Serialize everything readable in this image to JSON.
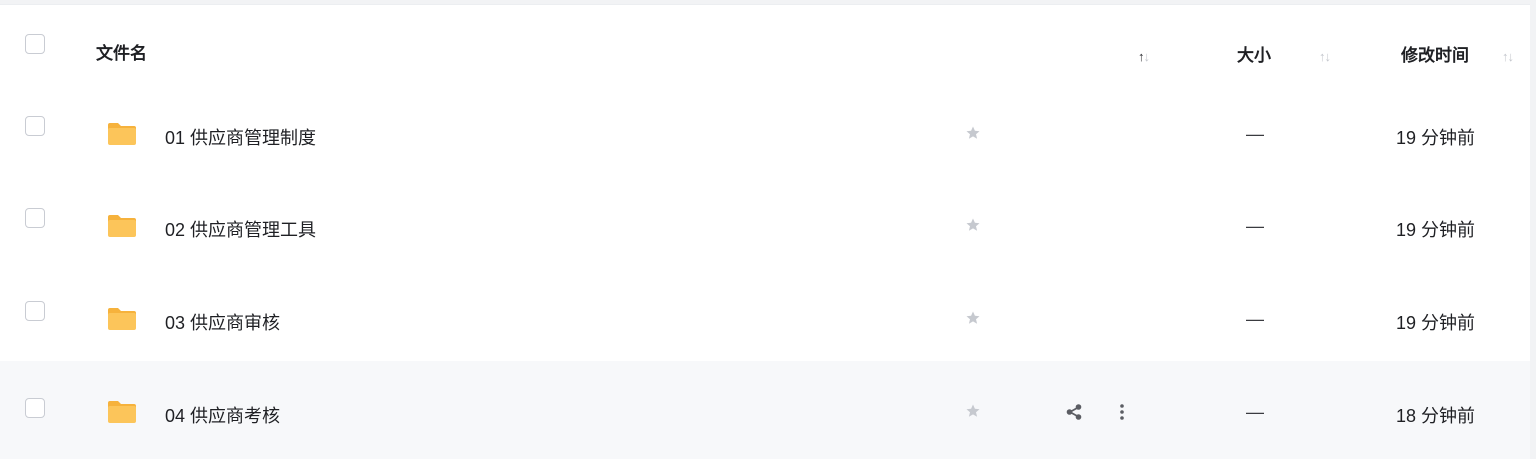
{
  "header": {
    "name_label": "文件名",
    "size_label": "大小",
    "time_label": "修改时间",
    "sort_up": "↑",
    "sort_down": "↓"
  },
  "rows": [
    {
      "name": "01 供应商管理制度",
      "size": "—",
      "modified": "19 分钟前",
      "starred": false,
      "hovered": false
    },
    {
      "name": "02 供应商管理工具",
      "size": "—",
      "modified": "19 分钟前",
      "starred": false,
      "hovered": false
    },
    {
      "name": "03 供应商审核",
      "size": "—",
      "modified": "19 分钟前",
      "starred": false,
      "hovered": false
    },
    {
      "name": "04 供应商考核",
      "size": "—",
      "modified": "18 分钟前",
      "starred": false,
      "hovered": true
    }
  ],
  "icons": {
    "folder": "folder-icon",
    "star": "star-icon",
    "share": "share-icon",
    "more": "more-vertical-icon"
  },
  "colors": {
    "folder_fill": "#fcc55a",
    "folder_tab": "#f6b23c",
    "star": "#c6c9cf",
    "action_icon": "#5b5d63",
    "hover_row_bg": "#f7f8fa"
  }
}
